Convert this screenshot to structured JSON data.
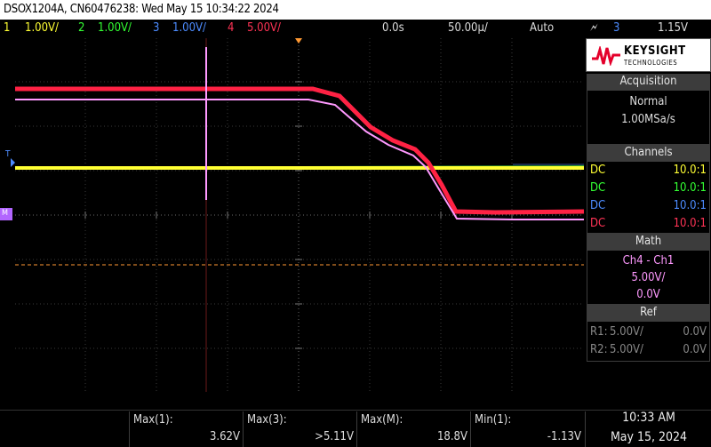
{
  "title": "DSOX1204A, CN60476238: Wed May 15 10:34:22 2024",
  "status": {
    "ch1": {
      "num": "1",
      "scale": "1.00V/",
      "color": "#ffff33"
    },
    "ch2": {
      "num": "2",
      "scale": "1.00V/",
      "color": "#33ff33"
    },
    "ch3": {
      "num": "3",
      "scale": "1.00V/",
      "color": "#4d8cff"
    },
    "ch4": {
      "num": "4",
      "scale": "5.00V/",
      "color": "#ff3355"
    },
    "time_offset": "0.0s",
    "time_scale": "50.00µ/",
    "trigger_mode": "Auto",
    "trigger_source": "3",
    "trigger_level": "1.15V"
  },
  "logo": {
    "brand": "KEYSIGHT",
    "sub": "TECHNOLOGIES"
  },
  "acquisition": {
    "heading": "Acquisition",
    "mode": "Normal",
    "rate": "1.00MSa/s"
  },
  "channels": {
    "heading": "Channels",
    "rows": [
      {
        "coupling": "DC",
        "probe": "10.0:1",
        "color": "#ffff33"
      },
      {
        "coupling": "DC",
        "probe": "10.0:1",
        "color": "#33ff33"
      },
      {
        "coupling": "DC",
        "probe": "10.0:1",
        "color": "#4d8cff"
      },
      {
        "coupling": "DC",
        "probe": "10.0:1",
        "color": "#ff3355"
      }
    ]
  },
  "math": {
    "heading": "Math",
    "func": "Ch4 - Ch1",
    "scale": "5.00V/",
    "offset": "0.0V",
    "color": "#ff99ff"
  },
  "ref": {
    "heading": "Ref",
    "r1": {
      "name": "R1:",
      "scale": "5.00V/",
      "offset": "0.0V"
    },
    "r2": {
      "name": "R2:",
      "scale": "5.00V/",
      "offset": "0.0V"
    }
  },
  "measurements": [
    {
      "label": "Max(1):",
      "value": "3.62V"
    },
    {
      "label": "Max(3):",
      "value": ">5.11V"
    },
    {
      "label": "Max(M):",
      "value": "18.8V"
    },
    {
      "label": "Min(1):",
      "value": "-1.13V"
    }
  ],
  "clock": {
    "time": "10:33 AM",
    "date": "May 15, 2024"
  },
  "markers": {
    "trigger_level_marker": "T",
    "math_marker": "M"
  }
}
